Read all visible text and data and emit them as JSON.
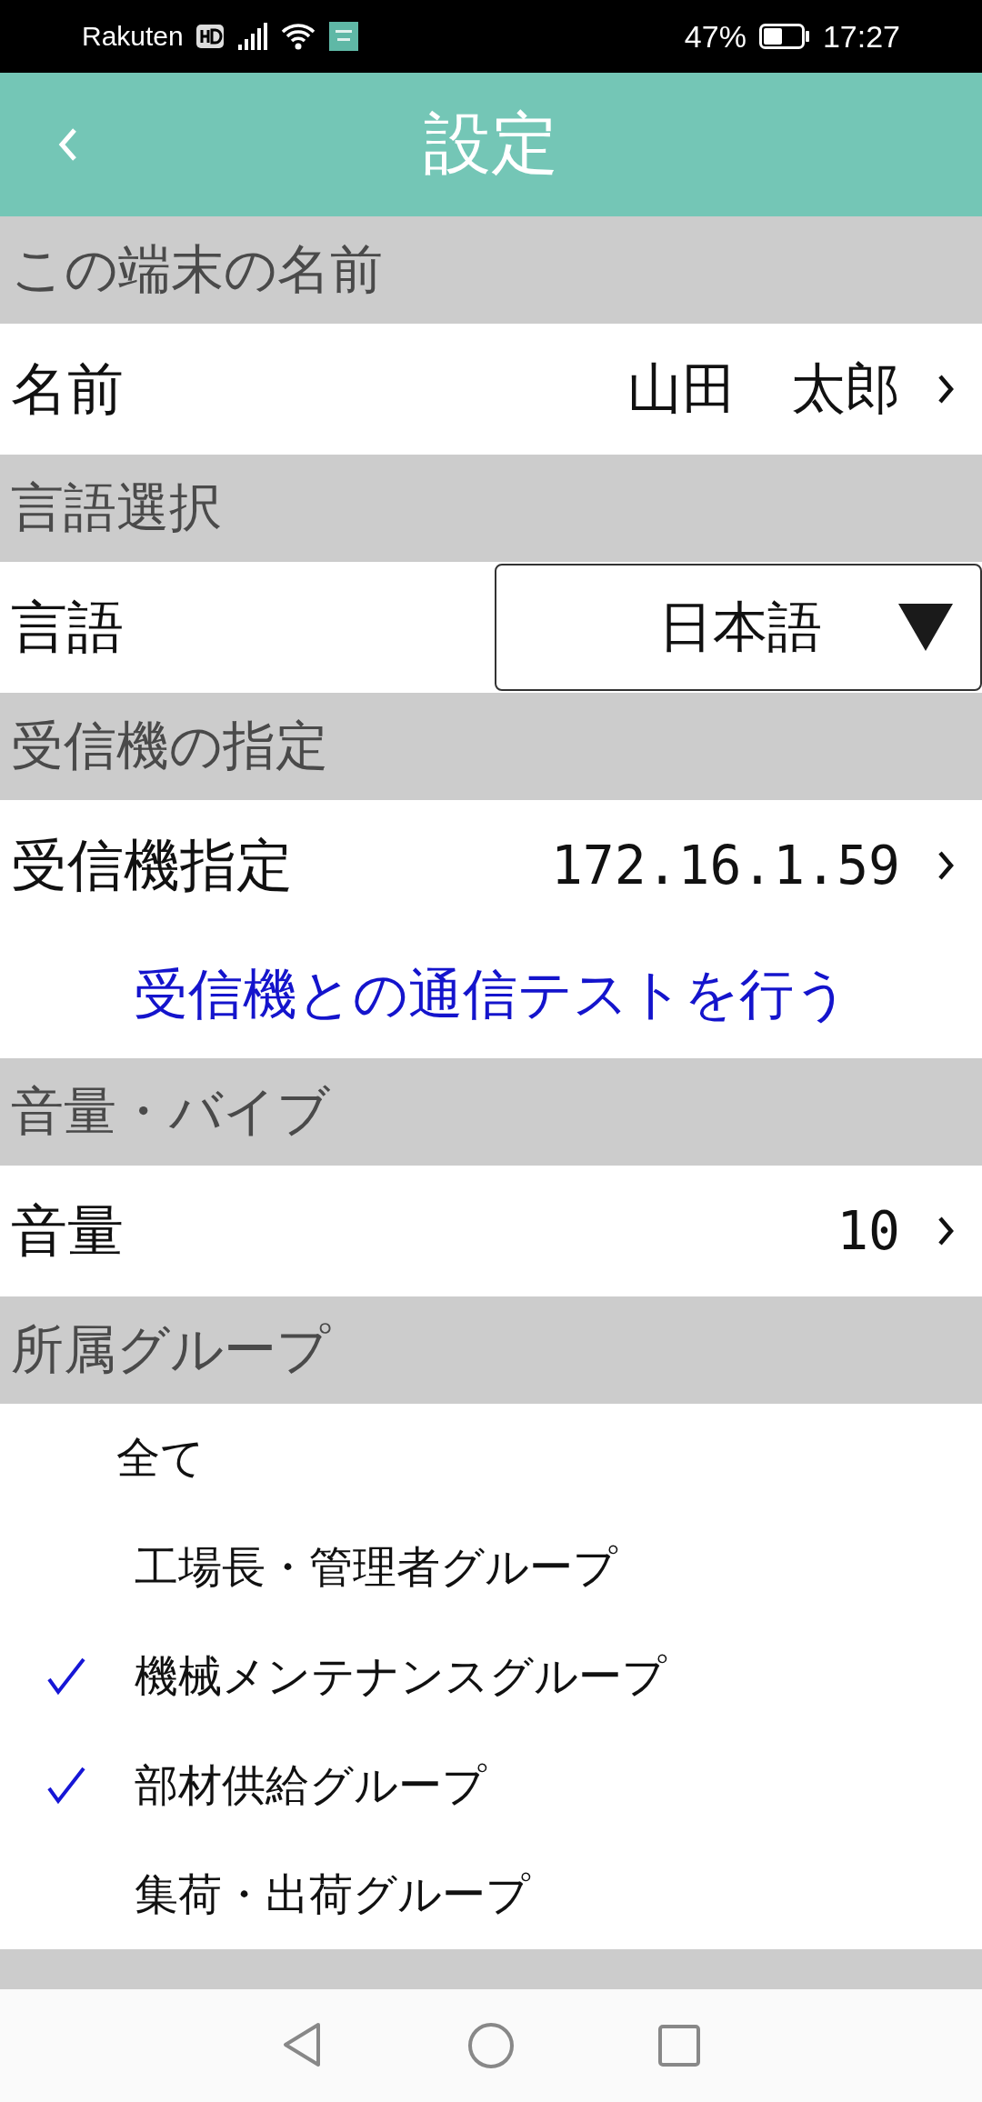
{
  "status_bar": {
    "carrier": "Rakuten",
    "battery_text": "47%",
    "time": "17:27"
  },
  "header": {
    "title": "設定"
  },
  "sections": [
    {
      "title": "この端末の名前",
      "rows": [
        {
          "kind": "value",
          "label": "名前",
          "value": "山田　太郎"
        }
      ]
    },
    {
      "title": "言語選択",
      "rows": [
        {
          "kind": "dropdown",
          "label": "言語",
          "value": "日本語"
        }
      ]
    },
    {
      "title": "受信機の指定",
      "rows": [
        {
          "kind": "value",
          "label": "受信機指定",
          "value": "172.16.1.59",
          "mono": true
        },
        {
          "kind": "link",
          "label": "受信機との通信テストを行う"
        }
      ]
    },
    {
      "title": "音量・バイブ",
      "rows": [
        {
          "kind": "value",
          "label": "音量",
          "value": "10",
          "mono": true
        }
      ]
    },
    {
      "title": "所属グループ",
      "groups": [
        {
          "label": "全て",
          "checked": false,
          "children": [
            {
              "label": "工場長・管理者グループ",
              "checked": false
            },
            {
              "label": "機械メンテナンスグループ",
              "checked": true
            },
            {
              "label": "部材供給グループ",
              "checked": true
            },
            {
              "label": "集荷・出荷グループ",
              "checked": false
            }
          ]
        }
      ]
    }
  ]
}
